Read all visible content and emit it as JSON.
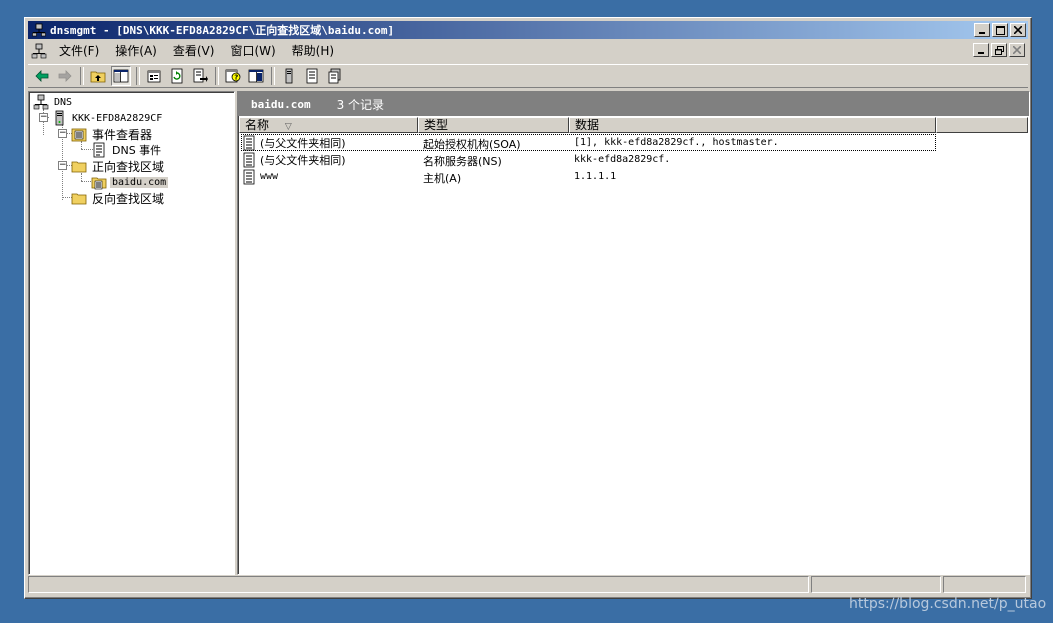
{
  "window": {
    "title": "dnsmgmt - [DNS\\KKK-EFD8A2829CF\\正向查找区域\\baidu.com]",
    "caption_buttons": [
      "minimize-icon",
      "maximize-icon",
      "close-icon"
    ]
  },
  "menu": {
    "items": [
      "文件(F)",
      "操作(A)",
      "查看(V)",
      "窗口(W)",
      "帮助(H)"
    ]
  },
  "mdi_buttons": [
    "minimize-icon",
    "restore-icon",
    "close-icon"
  ],
  "toolbar": {
    "buttons": [
      "back-icon",
      "forward-icon",
      "up-level-icon",
      "show-hide-tree-icon",
      "properties-icon",
      "refresh-icon",
      "export-list-icon",
      "help-icon",
      "show-hide-action-pane-icon",
      "new-record-icon",
      "new-host-icon",
      "new-domain-icon"
    ]
  },
  "tree": {
    "root": "DNS",
    "server": "KKK-EFD8A2829CF",
    "event_viewer": "事件查看器",
    "dns_events": "DNS 事件",
    "forward_zones": "正向查找区域",
    "zone": "baidu.com",
    "reverse_zones": "反向查找区域"
  },
  "detail": {
    "zone_name": "baidu.com",
    "record_count": "3 个记录",
    "columns": [
      "名称",
      "类型",
      "数据"
    ],
    "sort_indicator": "▽",
    "rows": [
      {
        "name": "(与父文件夹相同)",
        "type": "起始授权机构(SOA)",
        "data": "[1], kkk-efd8a2829cf., hostmaster."
      },
      {
        "name": "(与父文件夹相同)",
        "type": "名称服务器(NS)",
        "data": "kkk-efd8a2829cf."
      },
      {
        "name": "www",
        "type": "主机(A)",
        "data": "1.1.1.1"
      }
    ]
  },
  "watermark": "https://blog.csdn.net/p_utao"
}
